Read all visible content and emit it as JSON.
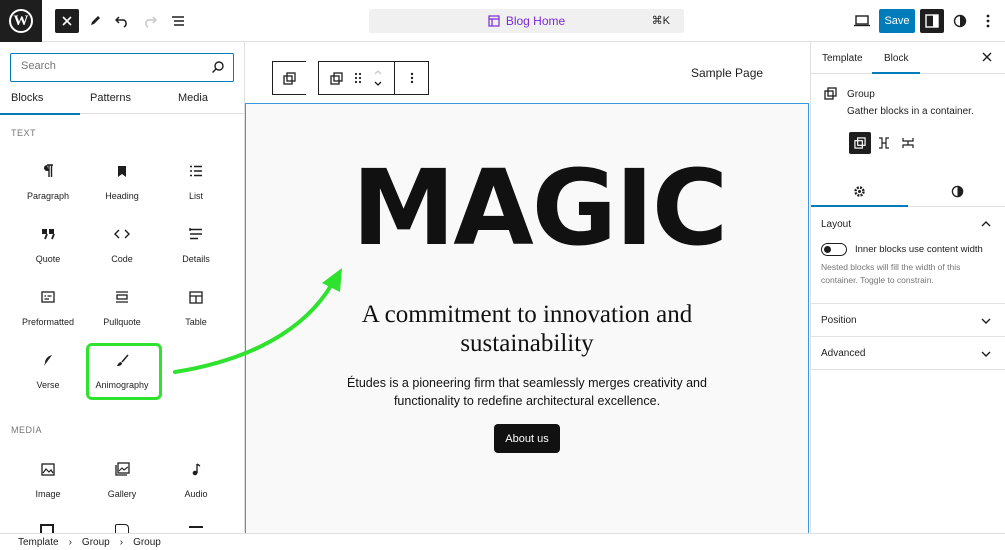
{
  "topbar": {
    "command_title": "Blog Home",
    "command_shortcut": "⌘K",
    "save_label": "Save"
  },
  "inserter": {
    "search_placeholder": "Search",
    "tabs": [
      "Blocks",
      "Patterns",
      "Media"
    ],
    "text_section": "TEXT",
    "media_section": "MEDIA",
    "text_blocks": [
      {
        "label": "Paragraph",
        "icon": "pilcrow-icon"
      },
      {
        "label": "Heading",
        "icon": "bookmark-icon"
      },
      {
        "label": "List",
        "icon": "list-icon"
      },
      {
        "label": "Quote",
        "icon": "quote-icon"
      },
      {
        "label": "Code",
        "icon": "code-icon"
      },
      {
        "label": "Details",
        "icon": "details-icon"
      },
      {
        "label": "Preformatted",
        "icon": "preformatted-icon"
      },
      {
        "label": "Pullquote",
        "icon": "pullquote-icon"
      },
      {
        "label": "Table",
        "icon": "table-icon"
      },
      {
        "label": "Verse",
        "icon": "feather-icon"
      },
      {
        "label": "Animography",
        "icon": "brush-icon"
      }
    ],
    "media_blocks": [
      {
        "label": "Image",
        "icon": "image-icon"
      },
      {
        "label": "Gallery",
        "icon": "gallery-icon"
      },
      {
        "label": "Audio",
        "icon": "audio-icon"
      }
    ]
  },
  "canvas": {
    "page_label": "Sample Page",
    "logo_text": "MAGIC",
    "hero_title_line1": "A commitment to innovation and",
    "hero_title_line2": "sustainability",
    "hero_text_line1": "Études is a pioneering firm that seamlessly merges creativity and",
    "hero_text_line2": "functionality to redefine architectural excellence.",
    "cta_label": "About us"
  },
  "sidebar": {
    "tabs": [
      "Template",
      "Block"
    ],
    "block_title": "Group",
    "block_desc": "Gather blocks in a container.",
    "layout_label": "Layout",
    "toggle_label": "Inner blocks use content width",
    "help_text": "Nested blocks will fill the width of this container. Toggle to constrain.",
    "position_label": "Position",
    "advanced_label": "Advanced"
  },
  "breadcrumb": [
    "Template",
    "Group",
    "Group"
  ],
  "colors": {
    "accent": "#007cba",
    "highlight": "#2ee22e",
    "arrow": "#2ee22e",
    "dark": "#1e1e1e"
  }
}
